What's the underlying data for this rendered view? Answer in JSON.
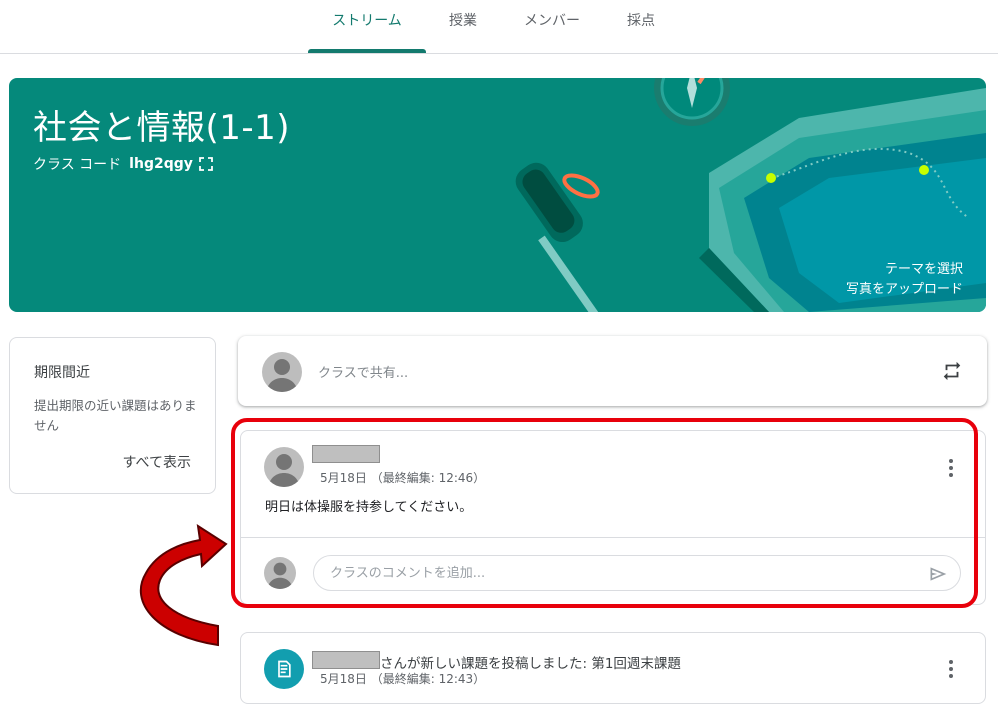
{
  "tabs": [
    {
      "label": "ストリーム",
      "active": true
    },
    {
      "label": "授業",
      "active": false
    },
    {
      "label": "メンバー",
      "active": false
    },
    {
      "label": "採点",
      "active": false
    }
  ],
  "banner": {
    "title": "社会と情報(1-1)",
    "code_label": "クラス コード",
    "code_value": "lhg2qgy",
    "theme_link": "テーマを選択",
    "upload_link": "写真をアップロード"
  },
  "upcoming": {
    "title": "期限間近",
    "message": "提出期限の近い課題はありません",
    "view_all": "すべて表示"
  },
  "share": {
    "placeholder": "クラスで共有..."
  },
  "post": {
    "date": "5月18日 （最終編集: 12:46）",
    "body": "明日は体操服を持参してください。",
    "comment_placeholder": "クラスのコメントを追加..."
  },
  "assignment": {
    "text": "さんが新しい課題を投稿しました: 第1回週末課題",
    "date": "5月18日 （最終編集: 12:43）"
  },
  "colors": {
    "accent": "#137a6e",
    "banner": "#05897b",
    "highlight": "#e8000b",
    "arrow": "#cc0000"
  },
  "icons": [
    "expand-icon",
    "repost-icon",
    "more-vert-icon",
    "send-icon",
    "assignment-icon",
    "avatar-icon"
  ]
}
